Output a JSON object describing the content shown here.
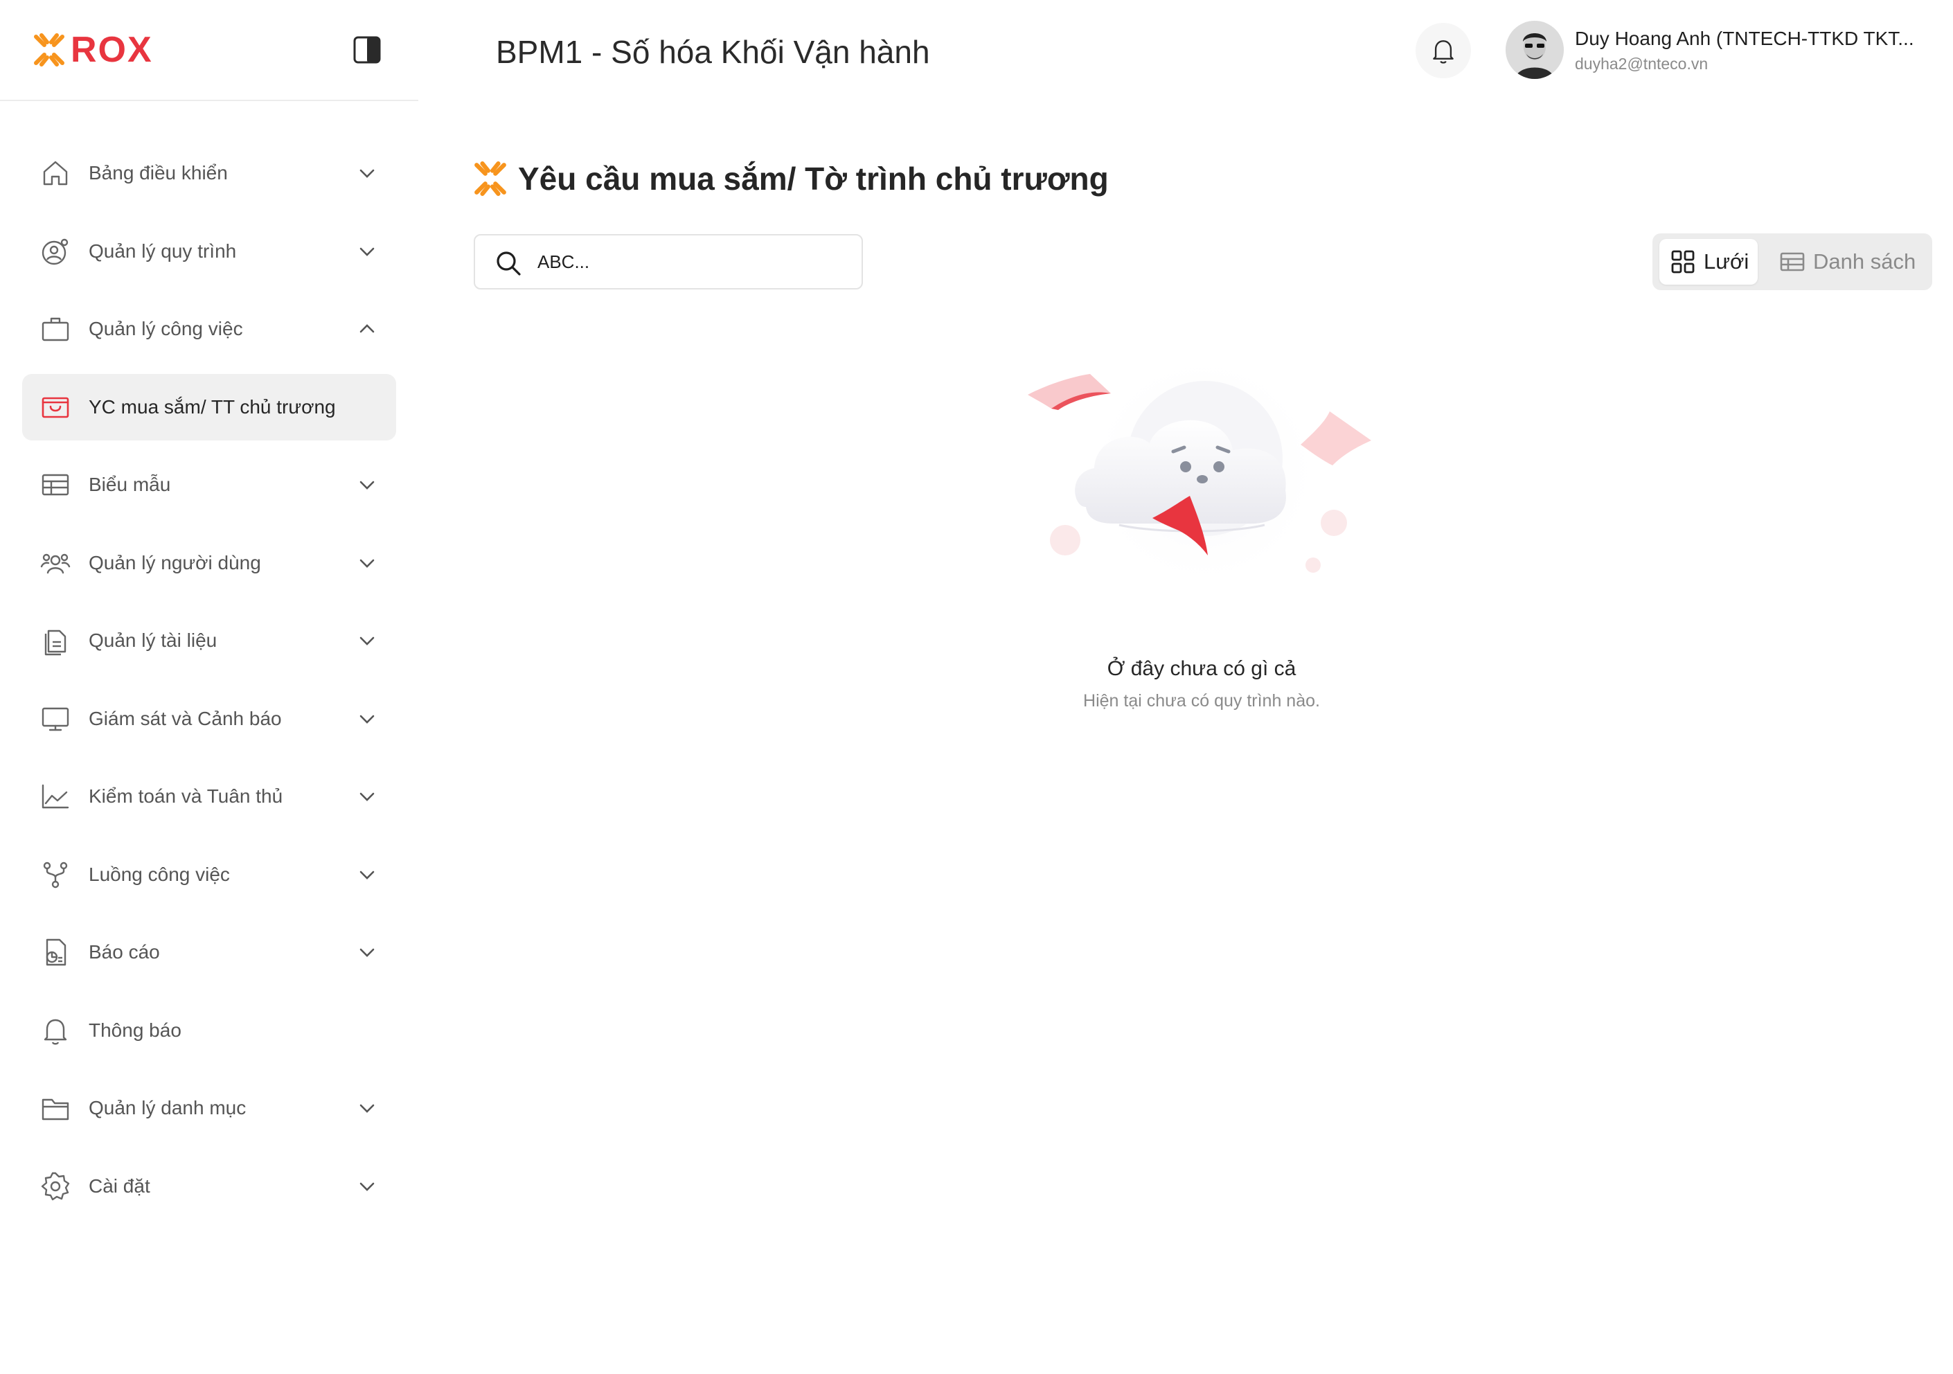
{
  "brand": {
    "logo_text": "ROX",
    "logo_icon": "rox-x-mark-icon",
    "brand_color": "#e8353f",
    "accent_color": "#f7941d"
  },
  "header": {
    "app_title": "BPM1 - Số hóa Khối Vận hành",
    "notification_icon": "bell-icon",
    "user": {
      "name": "Duy Hoang Anh (TNTECH-TTKD TKT...",
      "email": "duyha2@tnteco.vn"
    }
  },
  "sidebar": {
    "collapse_icon": "sidebar-toggle-icon",
    "items": [
      {
        "label": "Bảng điều khiển",
        "icon": "home-icon",
        "chevron": "down",
        "active": false
      },
      {
        "label": "Quản lý quy trình",
        "icon": "user-gear-icon",
        "chevron": "down",
        "active": false
      },
      {
        "label": "Quản lý công việc",
        "icon": "briefcase-icon",
        "chevron": "up",
        "active": false
      },
      {
        "label": "YC mua sắm/ TT chủ trương",
        "icon": "shopping-bag-icon",
        "chevron": "none",
        "active": true
      },
      {
        "label": "Biểu mẫu",
        "icon": "table-icon",
        "chevron": "down",
        "active": false
      },
      {
        "label": "Quản lý người dùng",
        "icon": "users-icon",
        "chevron": "down",
        "active": false
      },
      {
        "label": "Quản lý tài liệu",
        "icon": "documents-icon",
        "chevron": "down",
        "active": false
      },
      {
        "label": "Giám sát và Cảnh báo",
        "icon": "monitor-icon",
        "chevron": "down",
        "active": false
      },
      {
        "label": "Kiểm toán và Tuân thủ",
        "icon": "line-chart-icon",
        "chevron": "down",
        "active": false
      },
      {
        "label": "Luồng công việc",
        "icon": "workflow-icon",
        "chevron": "down",
        "active": false
      },
      {
        "label": "Báo cáo",
        "icon": "report-icon",
        "chevron": "down",
        "active": false
      },
      {
        "label": "Thông báo",
        "icon": "bell-icon",
        "chevron": "none",
        "active": false
      },
      {
        "label": "Quản lý danh mục",
        "icon": "folder-icon",
        "chevron": "down",
        "active": false
      },
      {
        "label": "Cài đặt",
        "icon": "settings-gear-icon",
        "chevron": "down",
        "active": false
      }
    ]
  },
  "main": {
    "page_title": "Yêu cầu mua sắm/ Tờ trình chủ trương",
    "search": {
      "value": "ABC...",
      "placeholder": "ABC..."
    },
    "view_toggle": {
      "grid_label": "Lưới",
      "list_label": "Danh sách",
      "selected": "grid"
    },
    "empty_state": {
      "illustration": "sad-cloud-illustration",
      "title": "Ở đây chưa có gì cả",
      "subtitle": "Hiện tại chưa có quy trình nào."
    }
  }
}
